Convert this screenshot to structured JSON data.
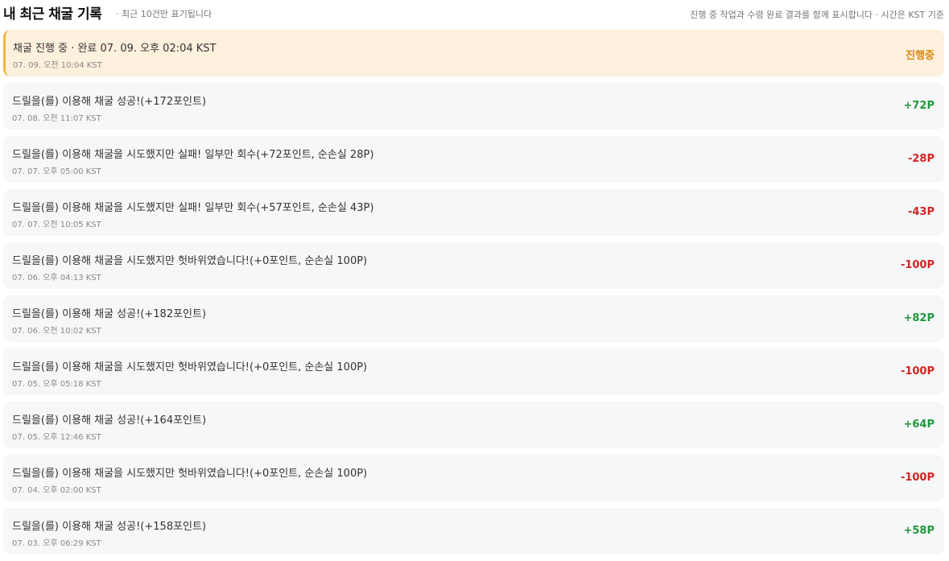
{
  "header": {
    "title": "내 최근 채굴 기록",
    "subtitle": "· 최근 10건만 표기됩니다",
    "note": "진행 중 작업과 수령 완료 결과를 함께 표시합니다 · 시간은 KST 기준"
  },
  "colors": {
    "pending": "#d9880c",
    "gain": "#23963d",
    "loss": "#d02525",
    "pending_bg": "#fdf0dd",
    "pending_border": "#f0b642",
    "row_bg": "#f6f7f9"
  },
  "records": [
    {
      "status": "pending",
      "text": "채굴 진행 중 · 완료 07. 09. 오후 02:04 KST",
      "time": "07. 09. 오전 10:04 KST",
      "points": "진행중"
    },
    {
      "status": "gain",
      "text": "드릴을(를) 이용해 채굴 성공!(+172포인트)",
      "time": "07. 08. 오전 11:07 KST",
      "points": "+72P"
    },
    {
      "status": "loss",
      "text": "드릴을(를) 이용해 채굴을 시도했지만 실패! 일부만 회수(+72포인트, 순손실 28P)",
      "time": "07. 07. 오후 05:00 KST",
      "points": "-28P"
    },
    {
      "status": "loss",
      "text": "드릴을(를) 이용해 채굴을 시도했지만 실패! 일부만 회수(+57포인트, 순손실 43P)",
      "time": "07. 07. 오전 10:05 KST",
      "points": "-43P"
    },
    {
      "status": "loss",
      "text": "드릴을(를) 이용해 채굴을 시도했지만 헛바위였습니다!(+0포인트, 순손실 100P)",
      "time": "07. 06. 오후 04:13 KST",
      "points": "-100P"
    },
    {
      "status": "gain",
      "text": "드릴을(를) 이용해 채굴 성공!(+182포인트)",
      "time": "07. 06. 오전 10:02 KST",
      "points": "+82P"
    },
    {
      "status": "loss",
      "text": "드릴을(를) 이용해 채굴을 시도했지만 헛바위였습니다!(+0포인트, 순손실 100P)",
      "time": "07. 05. 오후 05:18 KST",
      "points": "-100P"
    },
    {
      "status": "gain",
      "text": "드릴을(를) 이용해 채굴 성공!(+164포인트)",
      "time": "07. 05. 오후 12:46 KST",
      "points": "+64P"
    },
    {
      "status": "loss",
      "text": "드릴을(를) 이용해 채굴을 시도했지만 헛바위였습니다!(+0포인트, 순손실 100P)",
      "time": "07. 04. 오후 02:00 KST",
      "points": "-100P"
    },
    {
      "status": "gain",
      "text": "드릴을(를) 이용해 채굴 성공!(+158포인트)",
      "time": "07. 03. 오후 06:29 KST",
      "points": "+58P"
    }
  ]
}
